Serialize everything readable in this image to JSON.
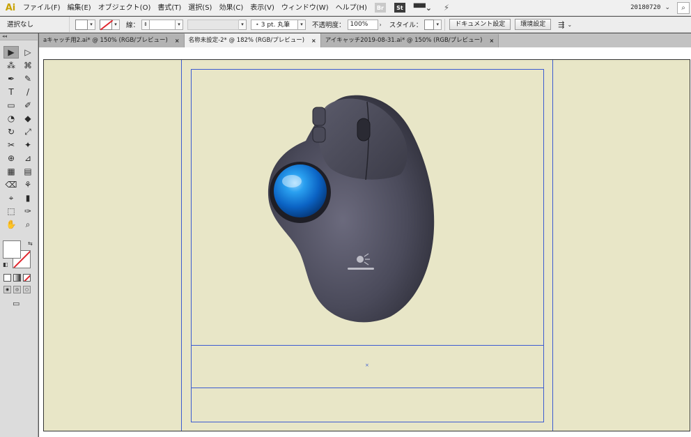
{
  "app": {
    "logo": "Ai",
    "menus": [
      "ファイル(F)",
      "編集(E)",
      "オブジェクト(O)",
      "書式(T)",
      "選択(S)",
      "効果(C)",
      "表示(V)",
      "ウィンドウ(W)",
      "ヘルプ(H)"
    ],
    "bridge_label": "Br",
    "stock_label": "St",
    "workspace": "20180720",
    "workspace_arrow": "⌄",
    "search_icon": "⌕"
  },
  "control_bar": {
    "selection_label": "選択なし",
    "stroke_label": "線：",
    "brush_size": "3 pt. 丸筆",
    "opacity_label": "不透明度：",
    "opacity_value": "100%",
    "style_label": "スタイル：",
    "doc_settings_button": "ドキュメント設定",
    "preferences_button": "環境設定",
    "dot": "•"
  },
  "tabs": [
    {
      "label": "aキャッチ用2.ai* @ 150% (RGB/プレビュー)",
      "close": "×"
    },
    {
      "label": "名称未設定-2* @ 182% (RGB/プレビュー)",
      "close": "×",
      "active": true
    },
    {
      "label": "アイキャッチ2019-08-31.ai* @ 150% (RGB/プレビュー)",
      "close": "×"
    }
  ],
  "tools": {
    "grip": "◂◂",
    "icons": [
      "▶",
      "▷",
      "⁂",
      "⌘",
      "✒",
      "✎",
      "T",
      "/",
      "▭",
      "✐",
      "◔",
      "◆",
      "↻",
      "⤢",
      "✂",
      "✦",
      "⊕",
      "⊿",
      "▦",
      "▤",
      "⌫",
      "⚘",
      "⌖",
      "▮",
      "⬚",
      "✑",
      "✋",
      "⌕"
    ],
    "swap": "⇆",
    "default": "◧",
    "screen_mode": "▭"
  },
  "canvas": {
    "center_mark": "×"
  },
  "colors": {
    "artboard": "#e8e6c7",
    "guide": "#3b5bd1",
    "accent_none": "#e0262d"
  }
}
